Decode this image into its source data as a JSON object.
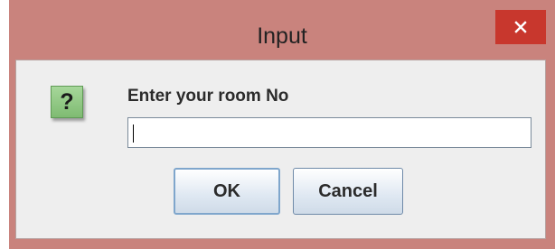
{
  "dialog": {
    "title": "Input",
    "close_icon": "close-icon",
    "question_icon": "question-icon",
    "question_glyph": "?",
    "prompt": "Enter your room No",
    "input_value": "",
    "ok_label": "OK",
    "cancel_label": "Cancel"
  },
  "colors": {
    "titlebar": "#c9837d",
    "close_button": "#c8372d",
    "client_bg": "#eeeeee",
    "question_icon_bg": "#8cc57f"
  }
}
